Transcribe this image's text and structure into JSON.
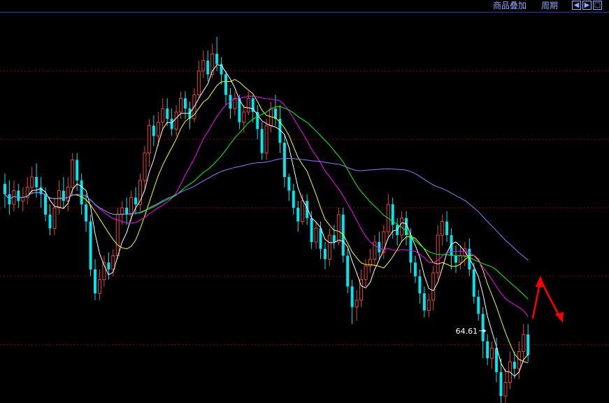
{
  "toolbar": {
    "overlay_label": "商品叠加",
    "period_label": "周期",
    "nav_left_icon": "arrow-left-icon",
    "nav_right_icon": "arrow-right-icon",
    "nav_expand_icon": "expand-icon",
    "link_color": "#8fa6ff"
  },
  "chart_data": {
    "type": "candlestick",
    "grid": true,
    "grid_color": "#8b0000",
    "up_color": "#e0453a",
    "down_color": "#00e5ee",
    "ylim": [
      62.5,
      73.5
    ],
    "low_annotation": {
      "text": "64.61",
      "value": 64.61,
      "index": 107
    },
    "bars": [
      [
        68.7,
        68.4,
        69.0,
        68.0
      ],
      [
        68.4,
        68.1,
        68.8,
        67.8
      ],
      [
        68.1,
        68.5,
        68.8,
        67.9
      ],
      [
        68.5,
        68.2,
        68.7,
        68.0
      ],
      [
        68.2,
        68.3,
        68.6,
        67.9
      ],
      [
        68.3,
        68.6,
        68.9,
        68.1
      ],
      [
        68.6,
        68.9,
        69.2,
        68.4
      ],
      [
        68.9,
        68.6,
        69.3,
        68.3
      ],
      [
        68.6,
        68.4,
        68.9,
        68.0
      ],
      [
        68.4,
        67.8,
        68.6,
        67.6
      ],
      [
        67.8,
        67.4,
        68.1,
        67.2
      ],
      [
        67.4,
        68.0,
        68.3,
        67.2
      ],
      [
        68.0,
        68.5,
        68.8,
        67.8
      ],
      [
        68.5,
        68.2,
        68.9,
        68.0
      ],
      [
        68.2,
        68.6,
        68.9,
        67.9
      ],
      [
        68.6,
        69.4,
        69.6,
        68.4
      ],
      [
        69.4,
        68.8,
        69.6,
        68.5
      ],
      [
        68.8,
        68.1,
        69.0,
        67.8
      ],
      [
        68.1,
        67.6,
        68.4,
        67.3
      ],
      [
        67.6,
        66.2,
        67.8,
        66.0
      ],
      [
        66.2,
        65.5,
        66.5,
        65.3
      ],
      [
        65.5,
        65.9,
        66.2,
        65.3
      ],
      [
        65.9,
        66.4,
        66.6,
        65.7
      ],
      [
        66.4,
        66.2,
        66.7,
        65.9
      ],
      [
        66.2,
        66.6,
        66.8,
        66.0
      ],
      [
        66.6,
        67.8,
        68.0,
        66.5
      ],
      [
        67.8,
        68.0,
        68.2,
        67.5
      ],
      [
        68.0,
        67.8,
        68.3,
        67.5
      ],
      [
        67.8,
        68.3,
        68.5,
        67.6
      ],
      [
        68.3,
        68.1,
        68.6,
        67.8
      ],
      [
        68.1,
        68.8,
        69.0,
        67.9
      ],
      [
        68.8,
        69.6,
        69.8,
        68.5
      ],
      [
        69.6,
        70.4,
        70.6,
        69.2
      ],
      [
        70.4,
        70.1,
        70.7,
        69.8
      ],
      [
        70.1,
        70.5,
        70.8,
        69.8
      ],
      [
        70.5,
        70.9,
        71.2,
        70.3
      ],
      [
        70.9,
        70.6,
        71.2,
        70.4
      ],
      [
        70.6,
        70.3,
        70.9,
        70.1
      ],
      [
        70.3,
        70.8,
        71.0,
        70.1
      ],
      [
        70.8,
        71.2,
        71.4,
        70.6
      ],
      [
        71.2,
        70.9,
        71.4,
        70.6
      ],
      [
        70.9,
        70.6,
        71.1,
        70.3
      ],
      [
        70.6,
        71.3,
        71.5,
        70.5
      ],
      [
        71.3,
        72.0,
        72.3,
        71.2
      ],
      [
        72.0,
        72.3,
        72.6,
        71.8
      ],
      [
        72.3,
        71.9,
        72.6,
        71.7
      ],
      [
        71.9,
        72.5,
        72.8,
        71.8
      ],
      [
        72.5,
        72.2,
        73.0,
        72.0
      ],
      [
        72.2,
        71.9,
        72.4,
        71.6
      ],
      [
        71.9,
        71.3,
        72.0,
        71.0
      ],
      [
        71.3,
        70.9,
        71.5,
        70.6
      ],
      [
        70.9,
        71.2,
        71.4,
        70.7
      ],
      [
        71.2,
        70.5,
        71.3,
        70.3
      ],
      [
        70.5,
        70.8,
        71.0,
        70.2
      ],
      [
        70.8,
        71.2,
        71.4,
        70.7
      ],
      [
        71.2,
        70.8,
        71.3,
        70.5
      ],
      [
        70.8,
        70.3,
        71.0,
        70.0
      ],
      [
        70.3,
        69.6,
        70.5,
        69.4
      ],
      [
        69.6,
        70.4,
        70.6,
        69.4
      ],
      [
        70.4,
        70.9,
        71.1,
        70.2
      ],
      [
        70.9,
        70.6,
        71.3,
        70.4
      ],
      [
        70.6,
        69.9,
        71.0,
        69.6
      ],
      [
        69.9,
        68.9,
        70.1,
        68.6
      ],
      [
        68.9,
        68.5,
        69.0,
        68.2
      ],
      [
        68.5,
        68.0,
        68.7,
        67.8
      ],
      [
        68.0,
        67.6,
        68.2,
        67.3
      ],
      [
        67.6,
        68.2,
        68.4,
        67.5
      ],
      [
        68.2,
        67.7,
        68.4,
        67.5
      ],
      [
        67.7,
        67.0,
        67.9,
        66.8
      ],
      [
        67.0,
        67.4,
        67.6,
        66.8
      ],
      [
        67.4,
        66.8,
        67.6,
        66.5
      ],
      [
        66.8,
        66.5,
        67.0,
        66.2
      ],
      [
        66.5,
        67.2,
        67.4,
        66.3
      ],
      [
        67.2,
        67.0,
        67.5,
        66.8
      ],
      [
        67.0,
        67.8,
        68.0,
        66.9
      ],
      [
        67.8,
        66.6,
        68.0,
        66.4
      ],
      [
        66.6,
        65.7,
        66.8,
        65.5
      ],
      [
        65.7,
        65.1,
        65.9,
        64.6
      ],
      [
        65.1,
        65.3,
        65.6,
        64.7
      ],
      [
        65.3,
        65.9,
        66.2,
        65.1
      ],
      [
        65.9,
        66.3,
        66.5,
        65.7
      ],
      [
        66.3,
        66.5,
        66.8,
        66.1
      ],
      [
        66.5,
        67.0,
        67.2,
        66.3
      ],
      [
        67.0,
        66.7,
        67.3,
        66.5
      ],
      [
        66.7,
        67.3,
        67.5,
        66.5
      ],
      [
        67.3,
        68.1,
        68.4,
        67.1
      ],
      [
        68.1,
        67.5,
        68.3,
        67.1
      ],
      [
        67.5,
        67.2,
        67.7,
        66.9
      ],
      [
        67.2,
        67.7,
        67.9,
        67.0
      ],
      [
        67.7,
        67.2,
        67.9,
        66.9
      ],
      [
        67.2,
        66.4,
        67.4,
        66.1
      ],
      [
        66.4,
        66.0,
        66.6,
        65.8
      ],
      [
        66.0,
        65.5,
        66.2,
        65.2
      ],
      [
        65.5,
        65.0,
        65.7,
        64.8
      ],
      [
        65.0,
        65.3,
        65.5,
        64.8
      ],
      [
        65.3,
        66.1,
        66.3,
        65.0
      ],
      [
        66.1,
        67.2,
        67.5,
        65.9
      ],
      [
        67.2,
        67.6,
        67.8,
        66.9
      ],
      [
        67.6,
        67.2,
        67.9,
        67.0
      ],
      [
        67.2,
        66.6,
        67.4,
        66.2
      ],
      [
        66.6,
        66.4,
        66.9,
        66.1
      ],
      [
        66.4,
        66.6,
        66.9,
        66.2
      ],
      [
        66.6,
        66.8,
        67.0,
        66.3
      ],
      [
        66.8,
        66.2,
        67.1,
        66.0
      ],
      [
        66.2,
        65.4,
        66.4,
        65.2
      ],
      [
        65.4,
        64.9,
        65.6,
        64.7
      ],
      [
        64.9,
        64.1,
        65.1,
        63.6
      ],
      [
        64.1,
        63.6,
        64.3,
        63.4
      ],
      [
        63.6,
        63.9,
        64.1,
        63.3
      ],
      [
        63.9,
        63.2,
        64.2,
        62.9
      ],
      [
        63.2,
        62.5,
        63.6,
        62.2
      ],
      [
        62.5,
        62.9,
        63.3,
        62.3
      ],
      [
        62.9,
        63.5,
        63.8,
        62.7
      ],
      [
        63.5,
        63.3,
        63.8,
        63.0
      ],
      [
        63.3,
        63.8,
        64.1,
        63.0
      ],
      [
        63.8,
        64.3,
        64.6,
        63.5
      ],
      [
        64.3,
        63.7,
        64.6,
        63.5
      ]
    ],
    "ma_colors": [
      "#ffffff",
      "#ffff00",
      "#ff00ff",
      "#00ff00",
      "#8080ff"
    ],
    "ma_periods": [
      5,
      10,
      20,
      30,
      60
    ],
    "forecast_arrow_color": "#ff0000"
  }
}
